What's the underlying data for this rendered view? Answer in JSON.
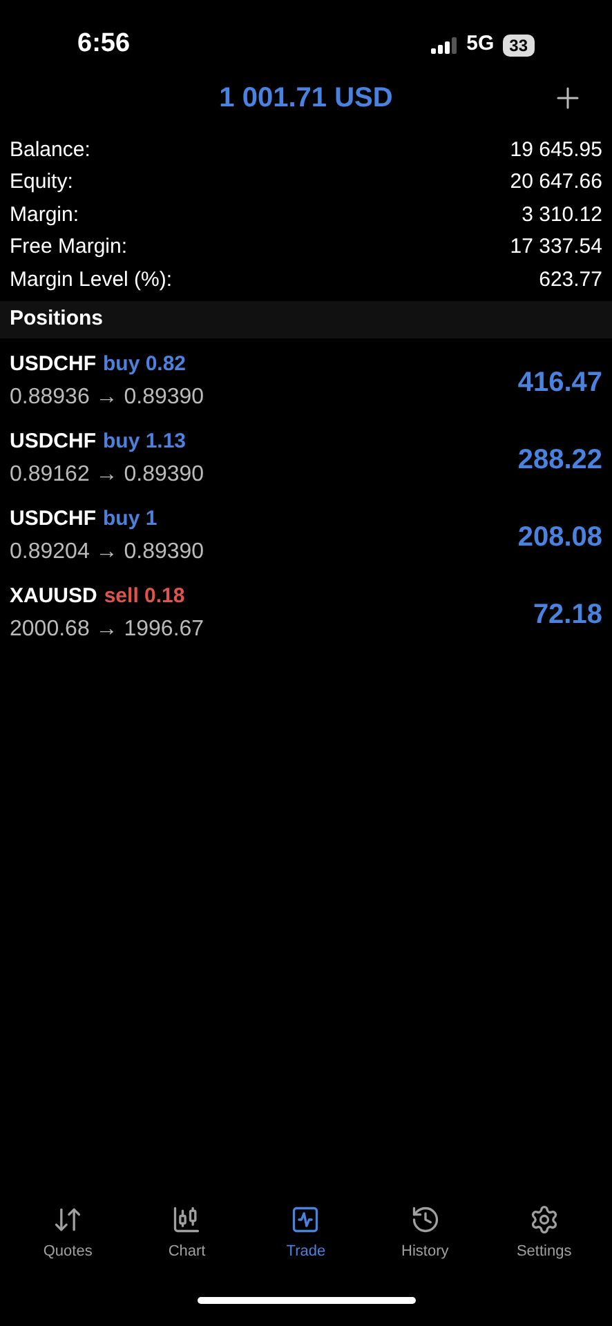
{
  "status_bar": {
    "time": "6:56",
    "network": "5G",
    "battery": "33"
  },
  "header": {
    "title": "1 001.71 USD"
  },
  "summary": [
    {
      "label": "Balance:",
      "value": "19 645.95"
    },
    {
      "label": "Equity:",
      "value": "20 647.66"
    },
    {
      "label": "Margin:",
      "value": "3 310.12"
    },
    {
      "label": "Free Margin:",
      "value": "17 337.54"
    },
    {
      "label": "Margin Level (%):",
      "value": "623.77"
    }
  ],
  "positions": {
    "title": "Positions",
    "items": [
      {
        "symbol": "USDCHF",
        "side": "buy",
        "volume": "0.82",
        "prices": "0.88936 → 0.89390",
        "profit": "416.47"
      },
      {
        "symbol": "USDCHF",
        "side": "buy",
        "volume": "1.13",
        "prices": "0.89162 → 0.89390",
        "profit": "288.22"
      },
      {
        "symbol": "USDCHF",
        "side": "buy",
        "volume": "1",
        "prices": "0.89204 → 0.89390",
        "profit": "208.08"
      },
      {
        "symbol": "XAUUSD",
        "side": "sell",
        "volume": "0.18",
        "prices": "2000.68 → 1996.67",
        "profit": "72.18"
      }
    ]
  },
  "tabs": [
    {
      "kind": "quotes",
      "label": "Quotes",
      "selected": false
    },
    {
      "kind": "chart",
      "label": "Chart",
      "selected": false
    },
    {
      "kind": "trade",
      "label": "Trade",
      "selected": true
    },
    {
      "kind": "history",
      "label": "History",
      "selected": false
    },
    {
      "kind": "settings",
      "label": "Settings",
      "selected": false
    }
  ]
}
